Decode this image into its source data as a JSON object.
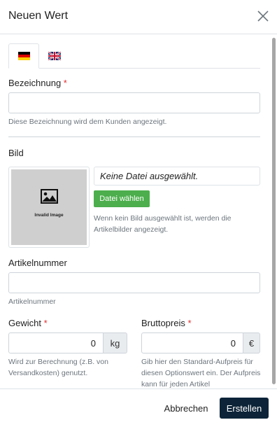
{
  "modal": {
    "title": "Neuen Wert"
  },
  "tabs": [
    {
      "name": "german-flag-icon",
      "active": true
    },
    {
      "name": "uk-flag-icon",
      "active": false
    }
  ],
  "fields": {
    "bezeichnung": {
      "label": "Bezeichnung",
      "required_mark": "*",
      "value": "",
      "hint": "Diese Bezeichnung wird dem Kunden angezeigt."
    },
    "bild": {
      "label": "Bild",
      "placeholder_image_text": "Invalid Image",
      "file_status": "Keine Datei ausgewählt.",
      "choose_button": "Datei wählen",
      "hint": "Wenn kein Bild ausgewählt ist, werden die Artikelbilder angezeigt."
    },
    "artikelnummer": {
      "label": "Artikelnummer",
      "value": "",
      "hint": "Artikelnummer"
    },
    "gewicht": {
      "label": "Gewicht",
      "required_mark": "*",
      "value": "0",
      "unit": "kg",
      "hint": "Wird zur Berechnung (z.B. von Versandkosten) genutzt."
    },
    "bruttopreis": {
      "label": "Bruttopreis",
      "required_mark": "*",
      "value": "0",
      "unit": "€",
      "hint": "Gib hier den Standard-Aufpreis für diesen Optionswert ein. Der Aufpreis kann für jeden Artikel"
    }
  },
  "footer": {
    "cancel_label": "Abbrechen",
    "create_label": "Erstellen"
  },
  "colors": {
    "primary": "#0d2438",
    "success": "#4cae4c",
    "required": "#e03131"
  }
}
